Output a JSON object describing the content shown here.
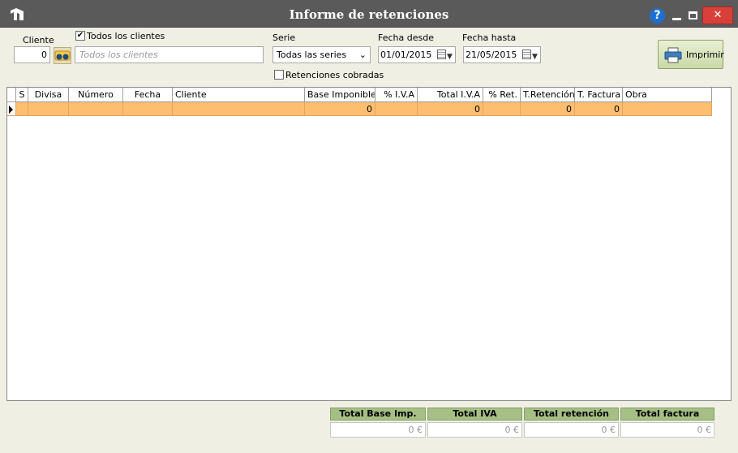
{
  "window": {
    "title": "Informe de retenciones",
    "help": "?",
    "close": "✕"
  },
  "filters": {
    "cliente_label": "Cliente",
    "cliente_value": "0",
    "todos_label": "Todos los clientes",
    "todos_checked": true,
    "clientes_placeholder": "Todos los clientes",
    "serie_label": "Serie",
    "serie_value": "Todas las series",
    "retenciones_label": "Retenciones cobradas",
    "retenciones_checked": false,
    "fecha_desde_label": "Fecha desde",
    "fecha_desde_value": "01/01/2015",
    "fecha_hasta_label": "Fecha hasta",
    "fecha_hasta_value": "21/05/2015"
  },
  "toolbar": {
    "print_label": "Imprimir"
  },
  "grid": {
    "columns": [
      "S",
      "Divisa",
      "Número",
      "Fecha",
      "Cliente",
      "Base Imponible",
      "% I.V.A",
      "Total I.V.A",
      "% Ret.",
      "T.Retención",
      "T. Factura",
      "Obra"
    ],
    "rows": [
      [
        "",
        "",
        "",
        "",
        "",
        "0",
        "",
        "0",
        "",
        "0",
        "0",
        ""
      ]
    ]
  },
  "totals": {
    "labels": [
      "Total Base Imp.",
      "Total IVA",
      "Total retención",
      "Total factura"
    ],
    "values": [
      "0 €",
      "0 €",
      "0 €",
      "0 €"
    ]
  },
  "colors": {
    "titlebar": "#5a5a5a",
    "selected_row": "#fdbe6f",
    "totals_header": "#a6bf84",
    "close": "#d9403a"
  }
}
